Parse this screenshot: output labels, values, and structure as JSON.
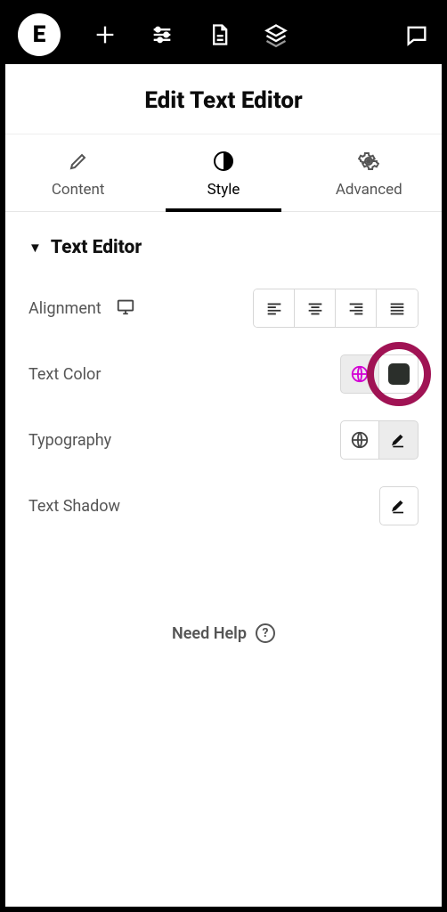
{
  "header": {
    "title": "Edit Text Editor"
  },
  "tabs": {
    "content": {
      "label": "Content"
    },
    "style": {
      "label": "Style"
    },
    "advanced": {
      "label": "Advanced"
    }
  },
  "section": {
    "title": "Text Editor"
  },
  "controls": {
    "alignment": {
      "label": "Alignment"
    },
    "text_color": {
      "label": "Text Color",
      "swatch": "#2b2f2b"
    },
    "typography": {
      "label": "Typography"
    },
    "text_shadow": {
      "label": "Text Shadow"
    }
  },
  "help": {
    "label": "Need Help"
  },
  "colors": {
    "globe_active": "#d400d4",
    "highlight": "#a01354"
  }
}
